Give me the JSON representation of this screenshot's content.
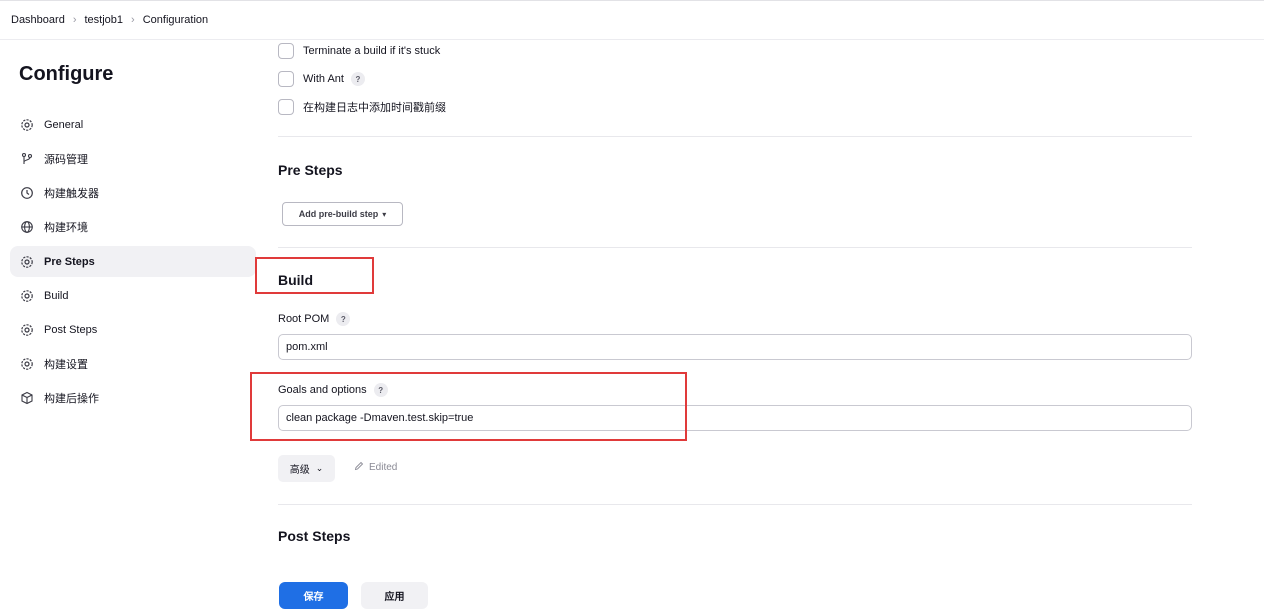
{
  "breadcrumb": {
    "items": [
      "Dashboard",
      "testjob1",
      "Configuration"
    ],
    "separator": ">"
  },
  "sidebar": {
    "title": "Configure",
    "items": [
      {
        "label": "General",
        "icon": "gear-icon"
      },
      {
        "label": "源码管理",
        "icon": "branch-icon"
      },
      {
        "label": "构建触发器",
        "icon": "clock-icon"
      },
      {
        "label": "构建环境",
        "icon": "globe-icon"
      },
      {
        "label": "Pre Steps",
        "icon": "gear-icon",
        "active": true
      },
      {
        "label": "Build",
        "icon": "gear-icon"
      },
      {
        "label": "Post Steps",
        "icon": "gear-icon"
      },
      {
        "label": "构建设置",
        "icon": "gear-icon"
      },
      {
        "label": "构建后操作",
        "icon": "package-icon"
      }
    ]
  },
  "options": {
    "terminate_label": "Terminate a build if it's stuck",
    "with_ant_label": "With Ant",
    "timestamp_label": "在构建日志中添加时间戳前缀",
    "help_glyph": "?"
  },
  "pre_steps": {
    "heading": "Pre Steps",
    "add_button": "Add pre-build step",
    "add_arrow": "▾"
  },
  "build": {
    "heading": "Build",
    "root_pom_label": "Root POM",
    "root_pom_value": "pom.xml",
    "goals_label": "Goals and options",
    "goals_value": "clean package -Dmaven.test.skip=true",
    "advanced_label": "高级",
    "edited_label": "Edited"
  },
  "post_steps": {
    "heading": "Post Steps"
  },
  "actions": {
    "save_label": "保存",
    "apply_label": "应用"
  },
  "colors": {
    "primary": "#1f6fe5",
    "highlight": "#e03a3a"
  }
}
